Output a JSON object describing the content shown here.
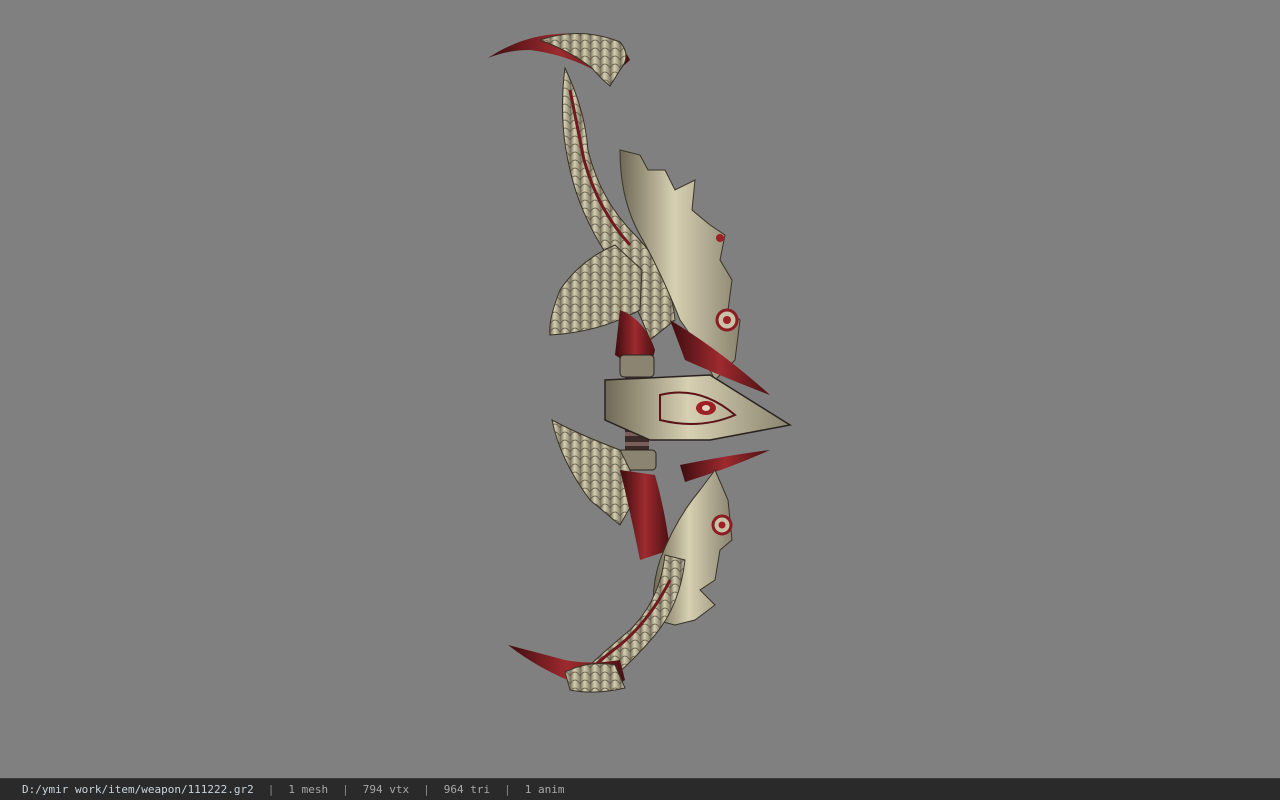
{
  "viewport": {
    "background_color": "#808080",
    "model_icon": "ornate-bow-model"
  },
  "status_bar": {
    "file_path": "D:/ymir work/item/weapon/111222.gr2",
    "separator": "|",
    "mesh_count": "1 mesh",
    "vertex_count": "794 vtx",
    "triangle_count": "964 tri",
    "anim_count": "1 anim"
  },
  "colors": {
    "bone": "#cfc8a8",
    "dark_red": "#7a1a1e",
    "blood_red": "#9e1f26",
    "shadow": "#2a2320"
  }
}
